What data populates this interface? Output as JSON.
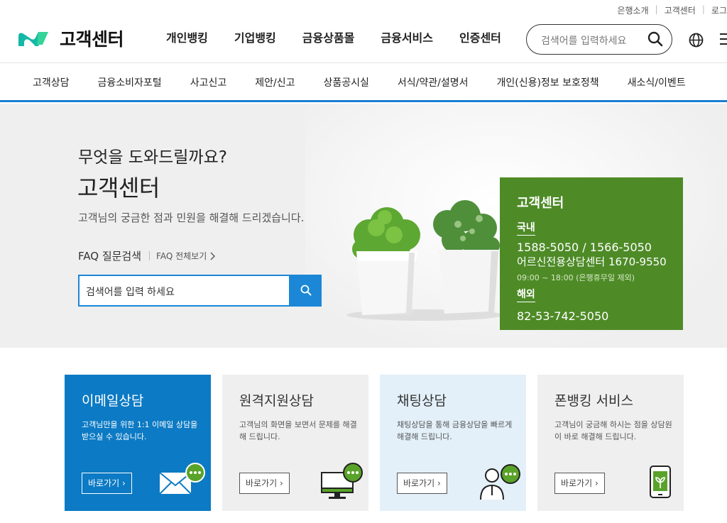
{
  "util_links": [
    "은행소개",
    "고객센터",
    "로그"
  ],
  "header": {
    "logo_text": "고객센터",
    "nav": [
      "개인뱅킹",
      "기업뱅킹",
      "금융상품몰",
      "금융서비스",
      "인증센터"
    ],
    "search_placeholder": "검색어를 입력하세요"
  },
  "subnav": [
    "고객상담",
    "금융소비자포털",
    "사고신고",
    "제안/신고",
    "상품공시실",
    "서식/약관/설명서",
    "개인(신용)정보 보호정책",
    "새소식/이벤트"
  ],
  "hero": {
    "subtitle": "무엇을 도와드릴까요?",
    "title": "고객센터",
    "description": "고객님의 궁금한 점과 민원을 해결해 드리겠습니다.",
    "faq_label": "FAQ 질문검색",
    "faq_all": "FAQ 전체보기",
    "faq_placeholder": "검색어를 입력 하세요"
  },
  "callbox": {
    "title": "고객센터",
    "domestic_label": "국내",
    "domestic_numbers": "1588-5050 / 1566-5050",
    "senior_line": "어르신전용상담센터 1670-9550",
    "hours": "09:00 ~ 18:00 (은행휴무일 제외)",
    "overseas_label": "해외",
    "overseas_number": "82-53-742-5050"
  },
  "cards": [
    {
      "title": "이메일상담",
      "desc": "고객님만을 위한 1:1 이메일 상담을 받으실 수 있습니다.",
      "button": "바로가기"
    },
    {
      "title": "원격지원상담",
      "desc": "고객님의 화면을 보면서 문제를 해결해 드립니다.",
      "button": "바로가기"
    },
    {
      "title": "채팅상담",
      "desc": "채팅상담을 통해 금융상담을 빠르게 해결해 드립니다.",
      "button": "바로가기"
    },
    {
      "title": "폰뱅킹 서비스",
      "desc": "고객님이 궁금해 하시는 점을 상담원이 바로 해결해 드립니다.",
      "button": "바로가기"
    }
  ],
  "colors": {
    "brand_green": "#4e8b27",
    "brand_blue": "#0c7ac4",
    "accent_blue": "#1b87d6",
    "logo_teal": "#14b8a6"
  }
}
